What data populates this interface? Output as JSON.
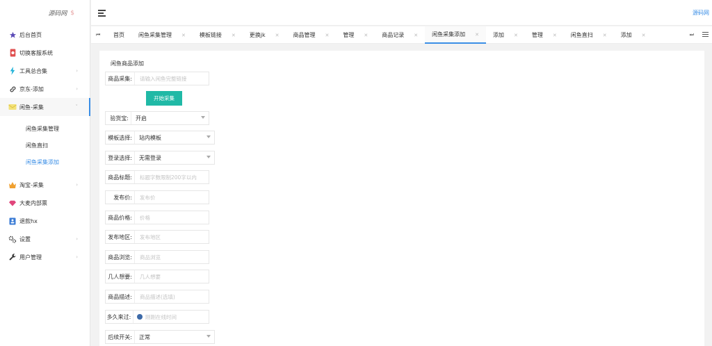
{
  "logo": {
    "text": "源码网",
    "mark": "$"
  },
  "header": {
    "brand_link": "源码网"
  },
  "sidebar": {
    "items": [
      {
        "label": "后台首页",
        "icon": "star-icon",
        "color": "#5b4bb7"
      },
      {
        "label": "切换客服系统",
        "icon": "card-icon",
        "color": "#e05050"
      },
      {
        "label": "工具总合集",
        "icon": "lightning-icon",
        "color": "#1fb2d8"
      },
      {
        "label": "京东-添加",
        "icon": "link-icon",
        "color": "#333333"
      },
      {
        "label": "闲鱼-采集",
        "icon": "envelope-icon",
        "color": "#e8d25a"
      },
      {
        "label": "淘宝-采集",
        "icon": "crown-icon",
        "color": "#f0a030"
      },
      {
        "label": "大麦内部票",
        "icon": "gem-icon",
        "color": "#e0457b"
      },
      {
        "label": "退款hx",
        "icon": "contact-card-icon",
        "color": "#3a7bd5"
      },
      {
        "label": "设置",
        "icon": "gears-icon",
        "color": "#333333"
      },
      {
        "label": "用户管理",
        "icon": "wrench-icon",
        "color": "#333333"
      }
    ],
    "sub_items": [
      "闲鱼采集管理",
      "闲鱼直扫",
      "闲鱼采集添加"
    ]
  },
  "tabs": [
    "首页",
    "闲鱼采集管理",
    "模板链接",
    "更换jk",
    "商品管理",
    "管理",
    "商品记录",
    "闲鱼采集添加",
    "添加",
    "管理",
    "闲鱼直扫",
    "添加"
  ],
  "form": {
    "title": "闲鱼商品添加",
    "collect_label": "商品采集:",
    "collect_placeholder": "请输入闲鱼完整链接",
    "collect_button": "开始采集",
    "check_label": "验货宝:",
    "check_value": "开启",
    "template_label": "模板选择:",
    "template_value": "站内模板",
    "login_label": "登录选择:",
    "login_value": "无需登录",
    "title_label": "商品标题:",
    "title_placeholder": "标题字数限制200字以内",
    "price_pub_label": "发布价:",
    "price_pub_placeholder": "发布价",
    "price_label": "商品价格:",
    "price_placeholder": "价格",
    "region_label": "发布地区:",
    "region_placeholder": "发布地区",
    "views_label": "商品浏览:",
    "views_placeholder": "商品浏览",
    "wants_label": "几人想要:",
    "wants_placeholder": "几人想要",
    "desc_label": "商品描述:",
    "desc_placeholder": "商品描述(选填)",
    "since_label": "多久来过:",
    "since_placeholder": "刚刚在线时间",
    "follow_label": "后续开关:",
    "follow_value": "正常"
  }
}
